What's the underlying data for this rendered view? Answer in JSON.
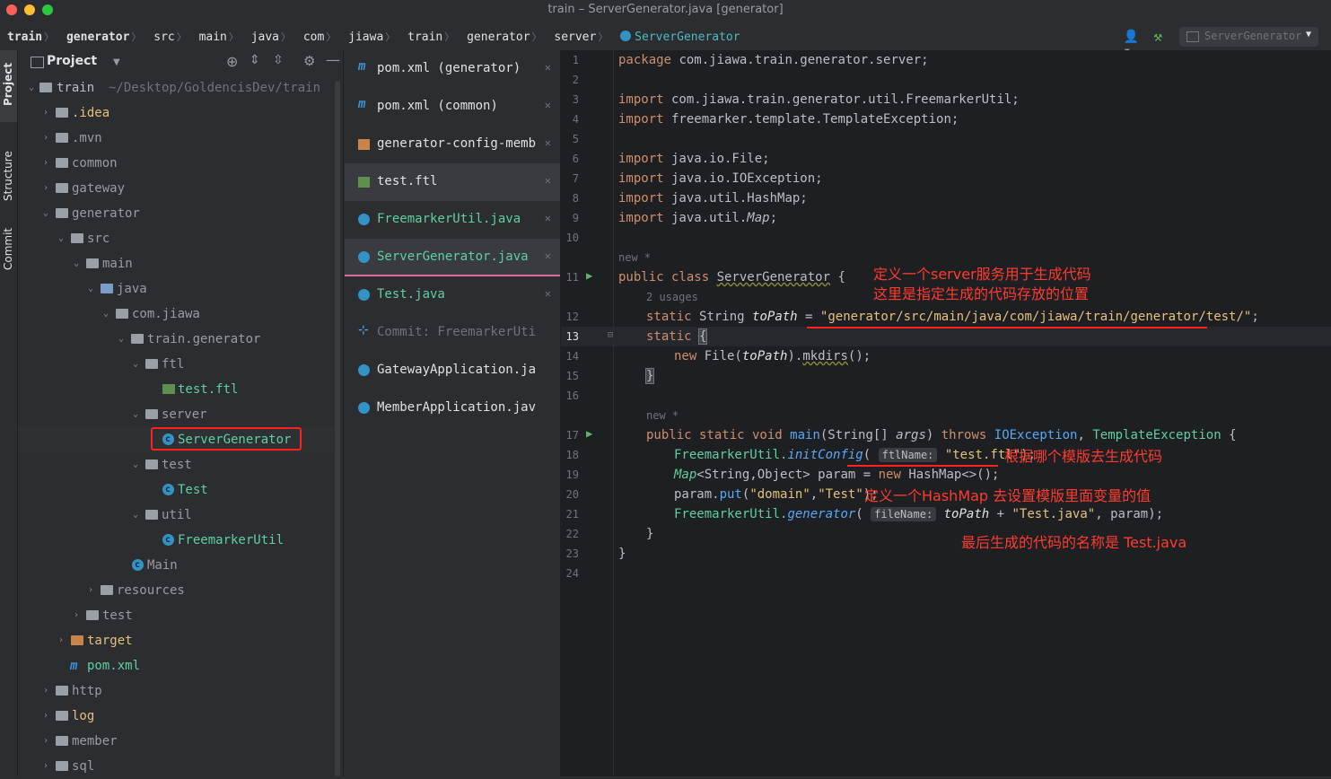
{
  "window": {
    "title": "train – ServerGenerator.java [generator]"
  },
  "breadcrumb": [
    "train",
    "generator",
    "src",
    "main",
    "java",
    "com",
    "jiawa",
    "train",
    "generator",
    "server",
    "ServerGenerator"
  ],
  "toolbar": {
    "run_config": "ServerGenerator"
  },
  "side_tabs": {
    "project": "Project",
    "structure": "Structure",
    "commit": "Commit"
  },
  "project_panel": {
    "title": "Project",
    "root_name": "train",
    "root_path": "~/Desktop/GoldencisDev/train",
    "items": [
      {
        "label": "train",
        "kind": "module"
      },
      {
        "label": ".idea",
        "kind": "folder"
      },
      {
        "label": ".mvn",
        "kind": "folder"
      },
      {
        "label": "common",
        "kind": "module"
      },
      {
        "label": "gateway",
        "kind": "module"
      },
      {
        "label": "generator",
        "kind": "module"
      },
      {
        "label": "src",
        "kind": "folder"
      },
      {
        "label": "main",
        "kind": "folder"
      },
      {
        "label": "java",
        "kind": "source"
      },
      {
        "label": "com.jiawa",
        "kind": "package"
      },
      {
        "label": "train.generator",
        "kind": "package"
      },
      {
        "label": "ftl",
        "kind": "package"
      },
      {
        "label": "test.ftl",
        "kind": "ftl"
      },
      {
        "label": "server",
        "kind": "package"
      },
      {
        "label": "ServerGenerator",
        "kind": "class"
      },
      {
        "label": "test",
        "kind": "package"
      },
      {
        "label": "Test",
        "kind": "class"
      },
      {
        "label": "util",
        "kind": "package"
      },
      {
        "label": "FreemarkerUtil",
        "kind": "class"
      },
      {
        "label": "Main",
        "kind": "class"
      },
      {
        "label": "resources",
        "kind": "resources"
      },
      {
        "label": "test",
        "kind": "folder"
      },
      {
        "label": "target",
        "kind": "excluded"
      },
      {
        "label": "pom.xml",
        "kind": "maven"
      },
      {
        "label": "http",
        "kind": "folder"
      },
      {
        "label": "log",
        "kind": "folder"
      },
      {
        "label": "member",
        "kind": "module"
      },
      {
        "label": "sql",
        "kind": "folder"
      }
    ]
  },
  "editor_tabs": [
    {
      "label": "pom.xml (generator)",
      "icon": "maven-icon"
    },
    {
      "label": "pom.xml (common)",
      "icon": "maven-icon"
    },
    {
      "label": "generator-config-memb",
      "icon": "xml-icon"
    },
    {
      "label": "test.ftl",
      "icon": "ftl-icon"
    },
    {
      "label": "FreemarkerUtil.java",
      "icon": "class-icon"
    },
    {
      "label": "ServerGenerator.java",
      "icon": "class-icon"
    },
    {
      "label": "Test.java",
      "icon": "class-icon"
    },
    {
      "label": "Commit: FreemarkerUti",
      "icon": "commit-icon"
    },
    {
      "label": "GatewayApplication.ja",
      "icon": "spring-class-icon"
    },
    {
      "label": "MemberApplication.jav",
      "icon": "spring-class-icon"
    }
  ],
  "line_numbers": [
    "1",
    "2",
    "3",
    "4",
    "5",
    "6",
    "7",
    "8",
    "9",
    "10",
    "11",
    "12",
    "13",
    "14",
    "15",
    "16",
    "17",
    "18",
    "19",
    "20",
    "21",
    "22",
    "23",
    "24"
  ],
  "code": {
    "l1_kw": "package",
    "l1_rest": " com.jiawa.train.generator.server;",
    "l3_kw": "import",
    "l3_rest": " com.jiawa.train.generator.util.FreemarkerUtil;",
    "l4_kw": "import",
    "l4_rest": " freemarker.template.TemplateException;",
    "l6_kw": "import",
    "l6_rest": " java.io.File;",
    "l7_kw": "import",
    "l7_rest": " java.io.IOException;",
    "l8_kw": "import",
    "l8_rest": " java.util.HashMap;",
    "l9_kw": "import",
    "l9_rest": " java.util.",
    "l9_map": "Map",
    "l9_end": ";",
    "new_hint": "new *",
    "l11_kw": "public class ",
    "l11_name": "ServerGenerator",
    "l11_end": " {",
    "usages_hint": "2 usages",
    "l12_kw": "static ",
    "l12_type": "String ",
    "l12_var": "toPath",
    "l12_eq": " = ",
    "l12_str": "\"generator/src/main/java/com/jiawa/train/generator/test/\"",
    "l12_end": ";",
    "l13_kw": "static ",
    "l13_brace": "{",
    "l14_kw": "new ",
    "l14_type": "File(",
    "l14_var": "toPath",
    "l14_mid": ").",
    "l14_fn": "mkdirs",
    "l14_end": "();",
    "l15": "}",
    "new_hint2": "new *",
    "l17_kw": "public static void ",
    "l17_fn": "main",
    "l17_a": "(String[] ",
    "l17_args": "args",
    "l17_b": ") ",
    "l17_kw2": "throws ",
    "l17_ex": "IOException",
    "l17_c": ", ",
    "l17_ex2": "TemplateException",
    "l17_d": " {",
    "l18_a": "FreemarkerUtil.",
    "l18_fn": "initConfig",
    "l18_b": "( ",
    "l18_hint": "ftlName:",
    "l18_str": "\"test.ftl\"",
    "l18_end": ");",
    "l19_map": "Map",
    "l19_rest": "<String,Object> param = ",
    "l19_kw": "new ",
    "l19_rest2": "HashMap<>();",
    "l20_a": "param.",
    "l20_fn": "put",
    "l20_b": "(",
    "l20_s1": "\"domain\"",
    "l20_c": ",",
    "l20_s2": "\"Test\"",
    "l20_end": ");",
    "l21_a": "FreemarkerUtil.",
    "l21_fn": "generator",
    "l21_b": "( ",
    "l21_hint": "fileName:",
    "l21_var": "toPath",
    "l21_c": " + ",
    "l21_str": "\"Test.java\"",
    "l21_end": ", param);",
    "l22": "}",
    "l23": "}"
  },
  "annotations": {
    "a1_line1": "定义一个server服务用于生成代码",
    "a1_line2": "这里是指定生成的代码存放的位置",
    "a2": "根据哪个模版去生成代码",
    "a3": "定义一个HashMap 去设置模版里面变量的值",
    "a4": "最后生成的代码的名称是 Test.java"
  },
  "colors": {
    "accent_pink": "#e06c9f",
    "annotation_red": "#ff3b30",
    "class_name_cyan": "#4fb9c2"
  }
}
